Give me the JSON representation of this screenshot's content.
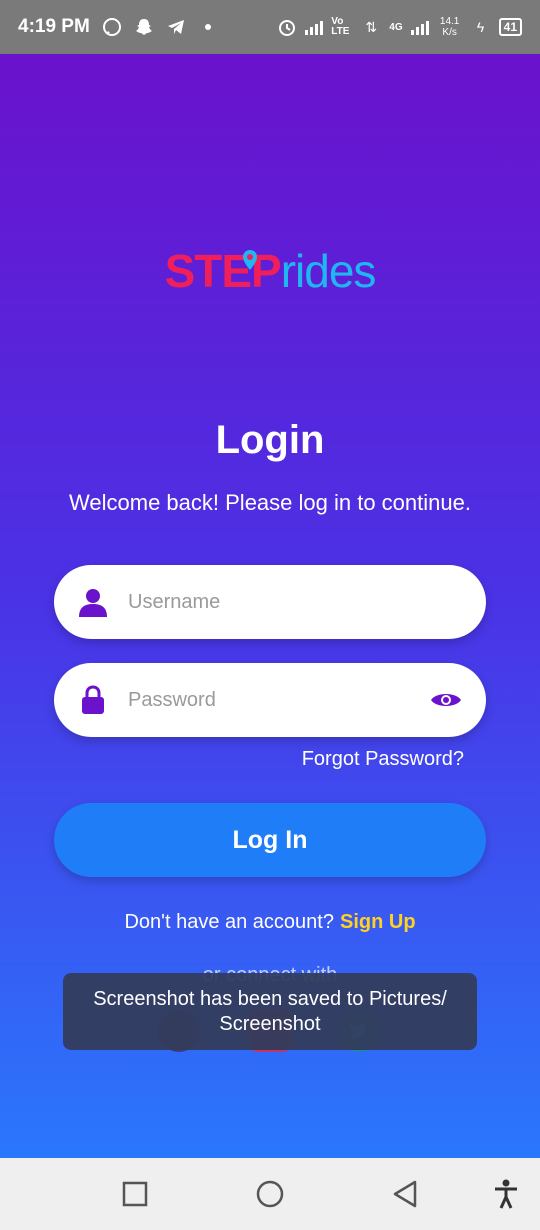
{
  "status_bar": {
    "time": "4:19 PM",
    "left_icons": [
      "whatsapp-icon",
      "snapchat-icon",
      "telegram-icon",
      "dot-icon"
    ],
    "volte": "Vo LTE",
    "network": "4G",
    "speed": "14.1 K/s",
    "battery": "41"
  },
  "logo": {
    "part1": "STEP",
    "part2": "rides"
  },
  "login": {
    "title": "Login",
    "subtitle": "Welcome back! Please log in to continue.",
    "username_placeholder": "Username",
    "password_placeholder": "Password",
    "forgot": "Forgot Password?",
    "button": "Log In",
    "no_account": "Don't have an account?",
    "signup": "Sign Up",
    "connect": "or connect with"
  },
  "toast": {
    "message": "Screenshot has been saved to  Pictures/ Screenshot"
  },
  "colors": {
    "gradient_top": "#6a12cc",
    "gradient_bottom": "#2a77fc",
    "accent_purple": "#6a12cc",
    "button_blue": "#1f7ef7",
    "signup_yellow": "#ffd21f",
    "logo_red": "#ee1f5b",
    "logo_blue": "#1fb7f2"
  }
}
